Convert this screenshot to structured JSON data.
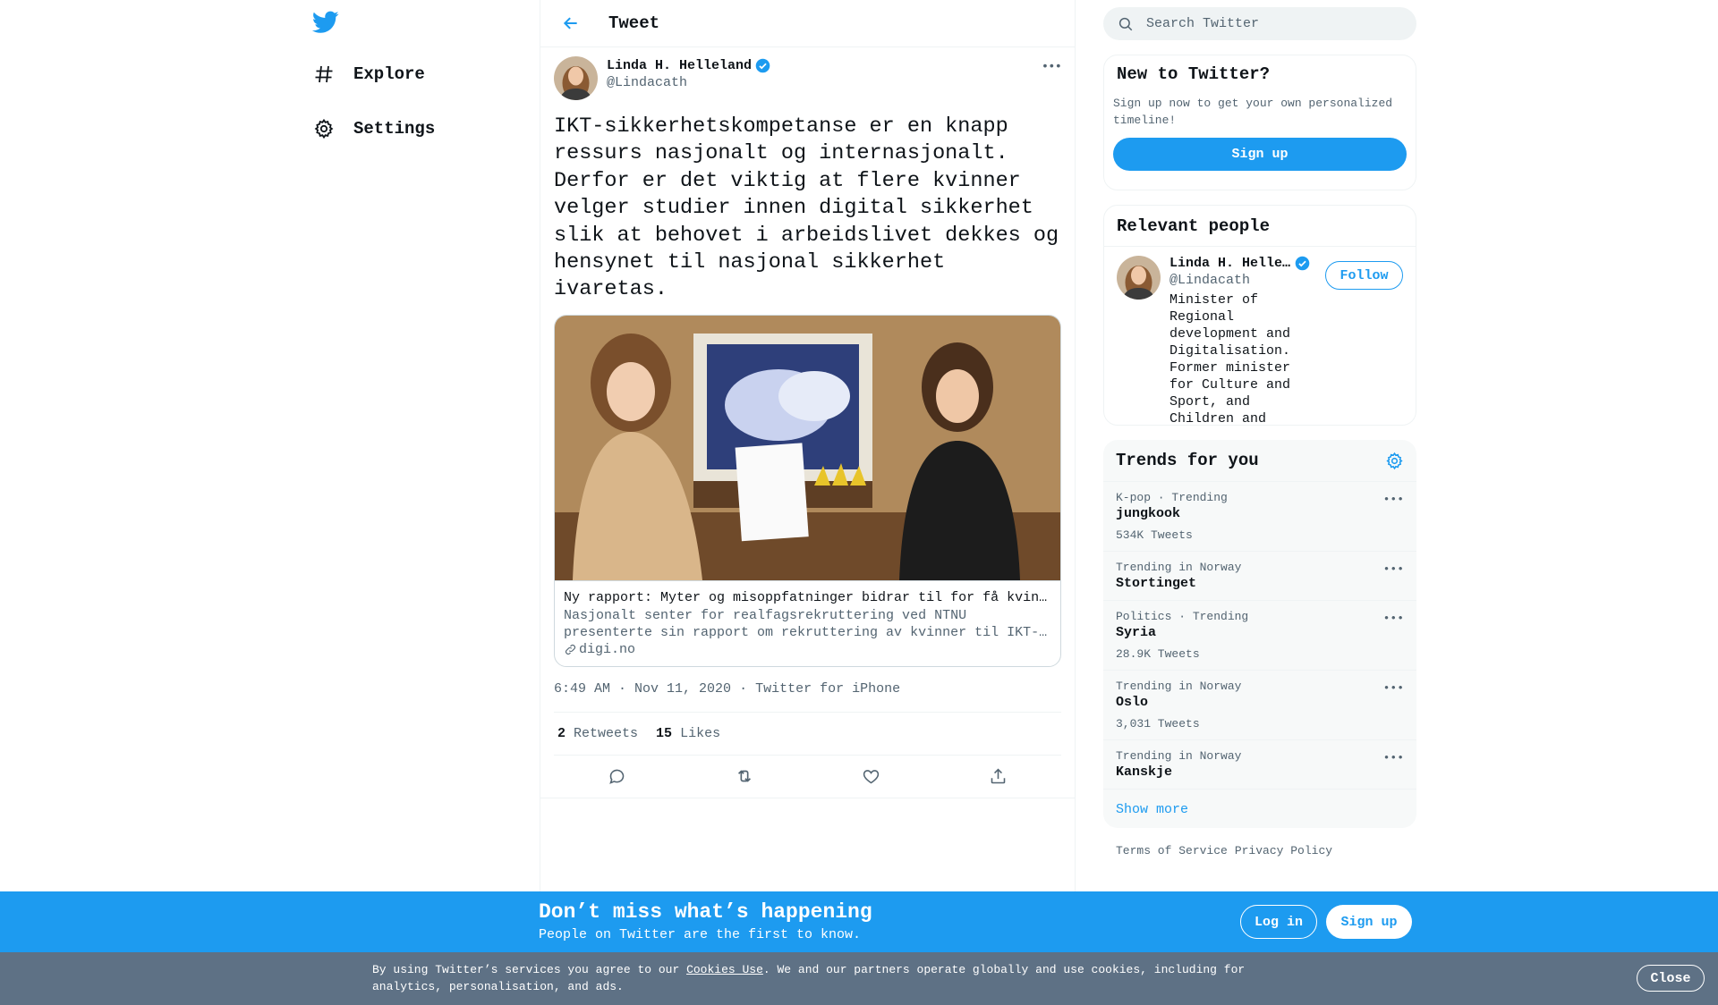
{
  "nav": {
    "logo_icon": "twitter-bird-icon",
    "items": [
      {
        "label": "Explore",
        "icon": "hashtag-icon"
      },
      {
        "label": "Settings",
        "icon": "gear-icon"
      }
    ]
  },
  "header": {
    "title": "Tweet",
    "back_icon": "arrow-left-icon"
  },
  "tweet": {
    "author_name": "Linda H. Helleland",
    "author_handle": "@Lindacath",
    "verified": true,
    "text": "IKT-sikkerhetskompetanse er en knapp ressurs nasjonalt og internasjonalt. Derfor er det viktig at flere kvinner velger studier innen digital sikkerhet slik at behovet i arbeidslivet dekkes og hensynet til nasjonal sikkerhet ivaretas.",
    "card": {
      "title": "Ny rapport: Myter og misoppfatninger bidrar til for få kvinner i IKT-sikkerhet",
      "description": "Nasjonalt senter for realfagsrekruttering ved NTNU presenterte sin rapport om rekruttering av kvinner til IKT-sikkerhetsutdanninger.",
      "domain": "digi.no"
    },
    "time": "6:49 AM · Nov 11, 2020",
    "source": "Twitter for iPhone",
    "retweets": "2",
    "retweets_label": "Retweets",
    "likes": "15",
    "likes_label": "Likes"
  },
  "search": {
    "placeholder": "Search Twitter"
  },
  "new_to_twitter": {
    "title": "New to Twitter?",
    "text": "Sign up now to get your own personalized timeline!",
    "button": "Sign up"
  },
  "relevant_people": {
    "title": "Relevant people",
    "person": {
      "name": "Linda H. Helleland",
      "handle": "@Lindacath",
      "bio": "Minister of Regional development and Digitalisation. Former minister for Culture and Sport, and Children and Equality. Conservative. Former VP of WADA.",
      "follow_label": "Follow"
    }
  },
  "trends": {
    "title": "Trends for you",
    "items": [
      {
        "context": "K-pop · Trending",
        "name": "jungkook",
        "count": "534K Tweets"
      },
      {
        "context": "Trending in Norway",
        "name": "Stortinget",
        "count": ""
      },
      {
        "context": "Politics · Trending",
        "name": "Syria",
        "count": "28.9K Tweets"
      },
      {
        "context": "Trending in Norway",
        "name": "Oslo",
        "count": "3,031 Tweets"
      },
      {
        "context": "Trending in Norway",
        "name": "Kanskje",
        "count": ""
      }
    ],
    "show_more": "Show more"
  },
  "footer": {
    "terms": "Terms of Service",
    "privacy": "Privacy Policy"
  },
  "banner": {
    "title": "Don’t miss what’s happening",
    "subtitle": "People on Twitter are the first to know.",
    "login": "Log in",
    "signup": "Sign up"
  },
  "cookie": {
    "prefix": "By using Twitter’s services you agree to our ",
    "link": "Cookies Use",
    "suffix": ". We and our partners operate globally and use cookies, including for analytics, personalisation, and ads.",
    "close": "Close"
  },
  "colors": {
    "accent": "#1d9bf0",
    "text": "#0f1419",
    "muted": "#536471",
    "cookie_bg": "#5e7185"
  }
}
